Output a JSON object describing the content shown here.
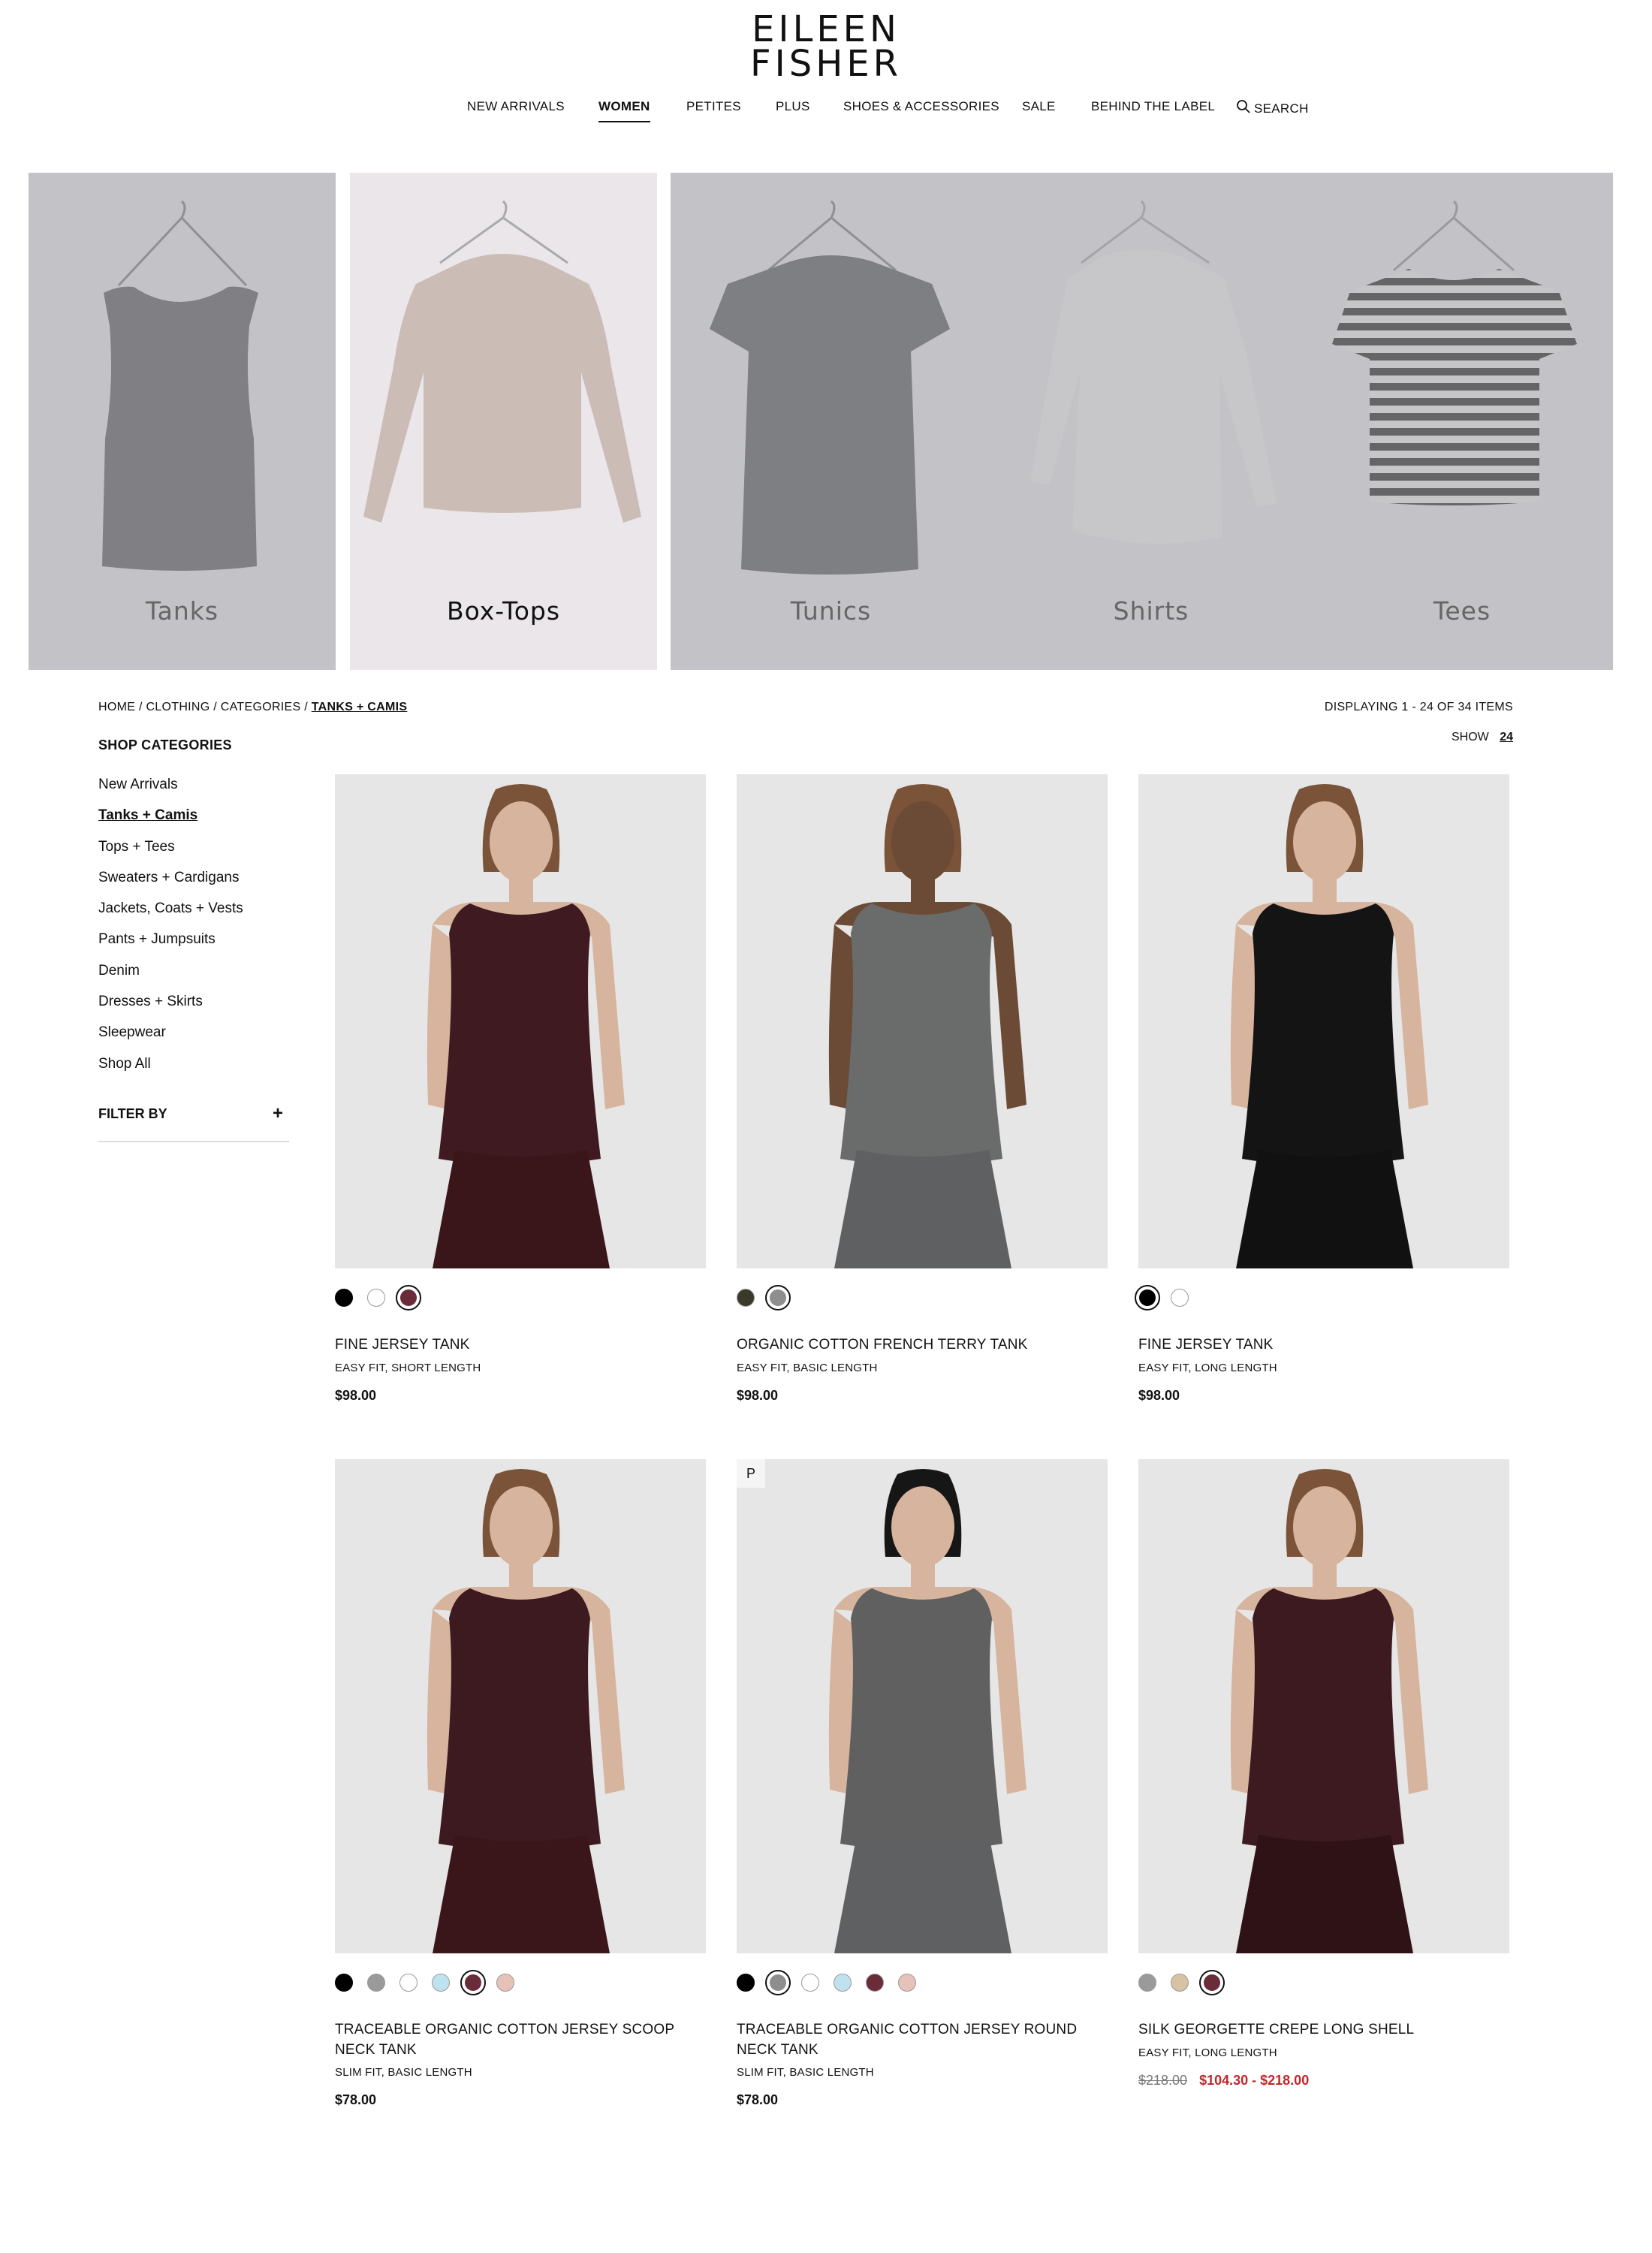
{
  "brand": {
    "line1": "EILEEN",
    "line2": "FISHER"
  },
  "nav": [
    {
      "label": "NEW ARRIVALS"
    },
    {
      "label": "WOMEN"
    },
    {
      "label": "PETITES"
    },
    {
      "label": "PLUS"
    },
    {
      "label": "SHOES & ACCESSORIES"
    },
    {
      "label": "SALE"
    },
    {
      "label": "BEHIND THE LABEL"
    },
    {
      "label": "SEARCH",
      "icon": "search-icon"
    }
  ],
  "nav_active": "WOMEN",
  "hero_tiles": [
    {
      "label": "Tanks",
      "garment": "tank",
      "color": "#7f7f82"
    },
    {
      "label": "Box-Tops",
      "garment": "sweater",
      "color": "#cbbdb6",
      "active": true
    },
    {
      "label": "Tunics",
      "garment": "tunic",
      "color": "#7b7e80"
    },
    {
      "label": "Shirts",
      "garment": "shirt",
      "color": "#f2f2f2"
    },
    {
      "label": "Tees",
      "garment": "tee",
      "color": "#e8e8e8"
    }
  ],
  "breadcrumb": {
    "home": "HOME",
    "clothing": "CLOTHING",
    "categories": "CATEGORIES",
    "current": "TANKS + CAMIS",
    "sep": "/"
  },
  "display_count": "DISPLAYING 1 - 24 OF 34 ITEMS",
  "show": {
    "label": "SHOW",
    "value": "24"
  },
  "sidebar": {
    "heading": "SHOP CATEGORIES",
    "items": [
      {
        "label": "New Arrivals"
      },
      {
        "label": "Tanks + Camis",
        "active": true
      },
      {
        "label": "Tops + Tees"
      },
      {
        "label": "Sweaters + Cardigans"
      },
      {
        "label": "Jackets, Coats + Vests"
      },
      {
        "label": "Pants + Jumpsuits"
      },
      {
        "label": "Denim"
      },
      {
        "label": "Dresses + Skirts"
      },
      {
        "label": "Sleepwear"
      },
      {
        "label": "Shop All"
      }
    ],
    "filter_label": "FILTER BY",
    "filter_icon": "plus-icon"
  },
  "products": [
    {
      "name": "FINE JERSEY TANK",
      "fit": "EASY FIT, SHORT LENGTH",
      "price": "$98.00",
      "garment_color": "#3f1a20",
      "bottom_color": "#3a161b",
      "swatches": [
        "#000000",
        "#ffffff",
        "#6b2c3a"
      ],
      "selected_swatch": 2
    },
    {
      "name": "ORGANIC COTTON FRENCH TERRY TANK",
      "fit": "EASY FIT, BASIC LENGTH",
      "price": "$98.00",
      "garment_color": "#6a6b6b",
      "bottom_color": "#5f6061",
      "skin": "#6b4a36",
      "swatches": [
        "#3b3a2a",
        "#8e8e8e"
      ],
      "selected_swatch": 1
    },
    {
      "name": "FINE JERSEY TANK",
      "fit": "EASY FIT, LONG LENGTH",
      "price": "$98.00",
      "garment_color": "#141414",
      "bottom_color": "#111111",
      "swatches": [
        "#000000",
        "#ffffff"
      ],
      "selected_swatch": 0
    },
    {
      "name": "TRACEABLE ORGANIC COTTON JERSEY SCOOP NECK TANK",
      "fit": "SLIM FIT, BASIC LENGTH",
      "price": "$78.00",
      "garment_color": "#3c1a20",
      "bottom_color": "#3a161b",
      "swatches": [
        "#000000",
        "#9a9a9a",
        "#ffffff",
        "#bfe3ee",
        "#6b2c3a",
        "#e6c2b8"
      ],
      "selected_swatch": 4
    },
    {
      "name": "TRACEABLE ORGANIC COTTON JERSEY ROUND NECK TANK",
      "fit": "SLIM FIT, BASIC LENGTH",
      "price": "$78.00",
      "badge": "P",
      "garment_color": "#606061",
      "bottom_color": "#5f6061",
      "hair": "#161616",
      "swatches": [
        "#000000",
        "#8e8e8e",
        "#ffffff",
        "#bfe3ee",
        "#6b2c3a",
        "#e6c2b8"
      ],
      "selected_swatch": 1
    },
    {
      "name": "SILK GEORGETTE CREPE LONG SHELL",
      "fit": "EASY FIT, LONG LENGTH",
      "price_original": "$218.00",
      "price_sale": "$104.30 - $218.00",
      "garment_color": "#3c1a1f",
      "bottom_color": "#2f1216",
      "swatches": [
        "#9a9a9a",
        "#d7c3a3",
        "#6b2c3a"
      ],
      "selected_swatch": 2
    }
  ]
}
